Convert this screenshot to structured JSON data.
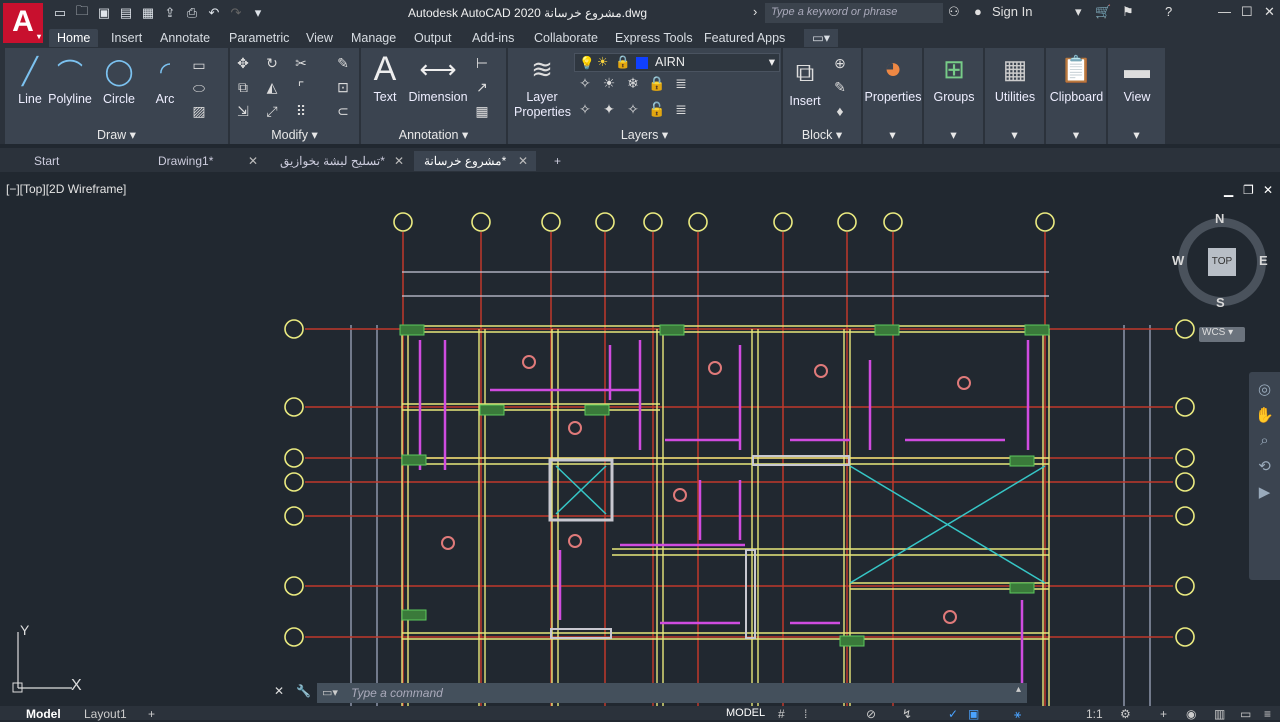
{
  "app": {
    "title": "Autodesk AutoCAD 2020  مشروع خرسانة.dwg",
    "logo": "A"
  },
  "search": {
    "placeholder": "Type a keyword or phrase"
  },
  "signin": "Sign In",
  "ribbon_tabs": [
    "Home",
    "Insert",
    "Annotate",
    "Parametric",
    "View",
    "Manage",
    "Output",
    "Add-ins",
    "Collaborate",
    "Express Tools",
    "Featured Apps"
  ],
  "draw": {
    "line": "Line",
    "polyline": "Polyline",
    "circle": "Circle",
    "arc": "Arc",
    "panel": "Draw"
  },
  "modify": {
    "panel": "Modify"
  },
  "annotation": {
    "text": "Text",
    "dimension": "Dimension",
    "panel": "Annotation"
  },
  "layers": {
    "layer_properties": "Layer Properties",
    "current_layer": "AIRN",
    "panel": "Layers"
  },
  "block": {
    "insert": "Insert",
    "panel": "Block"
  },
  "groups": {
    "properties": "Properties",
    "groups": "Groups",
    "utilities": "Utilities",
    "clipboard": "Clipboard",
    "view": "View"
  },
  "file_tabs": [
    {
      "label": "Start"
    },
    {
      "label": "Drawing1*"
    },
    {
      "label": "تسليح لبشة بخوازيق*"
    },
    {
      "label": "مشروع خرسانة*"
    }
  ],
  "viewport": {
    "label": "[−][Top][2D Wireframe]"
  },
  "viewcube": {
    "n": "N",
    "s": "S",
    "e": "E",
    "w": "W",
    "top": "TOP",
    "wcs": "WCS"
  },
  "ucs": {
    "x": "X",
    "y": "Y"
  },
  "command": {
    "placeholder": "Type  a  command"
  },
  "status": {
    "model": "Model",
    "layout1": "Layout1",
    "model_btn": "MODEL",
    "scale": "1:1"
  },
  "colors": {
    "bg": "#212830",
    "grid_red": "#c0392b",
    "beam_yellow": "#e8e87a",
    "magenta": "#d04ce0",
    "cyan": "#36c6c6",
    "green": "#5cc85c"
  }
}
